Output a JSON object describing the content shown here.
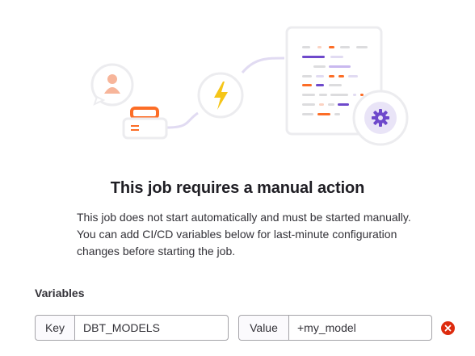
{
  "empty_state": {
    "title": "This job requires a manual action",
    "description": "This job does not start automatically and must be started manually. You can add CI/CD variables below for last-minute configuration changes before starting the job."
  },
  "variables": {
    "label": "Variables",
    "rows": [
      {
        "key_addon": "Key",
        "key_value": "DBT_MODELS",
        "value_addon": "Value",
        "value_value": "+my_model"
      }
    ]
  },
  "colors": {
    "accent_purple": "#6e49cb",
    "accent_orange": "#fc6d26",
    "remove_red": "#dd2b0e"
  },
  "icons": [
    "user-icon",
    "lightning-icon",
    "gear-icon",
    "remove-icon"
  ]
}
